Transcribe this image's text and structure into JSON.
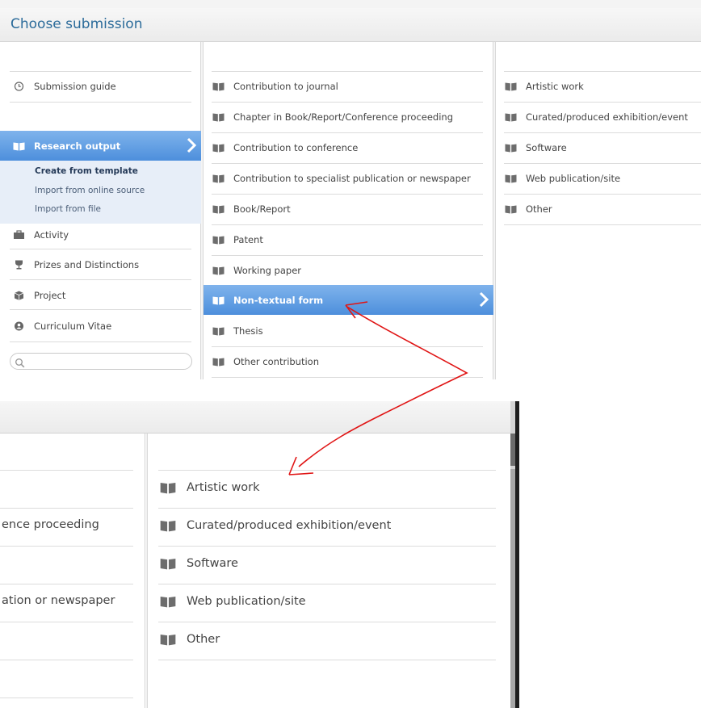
{
  "window": {
    "title": "Choose submission"
  },
  "nav": {
    "submission_guide": "Submission guide",
    "research_output": "Research output",
    "research_submenu": [
      "Create from template",
      "Import from online source",
      "Import from file"
    ],
    "items": [
      "Activity",
      "Prizes and Distinctions",
      "Project",
      "Curriculum Vitae"
    ],
    "search_placeholder": ""
  },
  "templates": [
    "Contribution to journal",
    "Chapter in Book/Report/Conference proceeding",
    "Contribution to conference",
    "Contribution to specialist publication or newspaper",
    "Book/Report",
    "Patent",
    "Working paper",
    "Non-textual form",
    "Thesis",
    "Other contribution"
  ],
  "subtypes": [
    "Artistic work",
    "Curated/produced exhibition/event",
    "Software",
    "Web publication/site",
    "Other"
  ],
  "zoom": {
    "left_fragments": [
      "ence proceeding",
      "ation or newspaper"
    ],
    "subtypes": [
      "Artistic work",
      "Curated/produced exhibition/event",
      "Software",
      "Web publication/site",
      "Other"
    ]
  },
  "colors": {
    "title": "#2b6b9a",
    "selected_top": "#7fb3ec",
    "selected_bottom": "#4d8fdc",
    "annotation": "#e01515"
  },
  "icons": {
    "book": "book-icon",
    "guide": "clock-icon",
    "activity": "briefcase-icon",
    "prizes": "trophy-icon",
    "project": "box-icon",
    "cv": "person-icon",
    "search": "search-icon",
    "chevron": "chevron-right-icon"
  }
}
